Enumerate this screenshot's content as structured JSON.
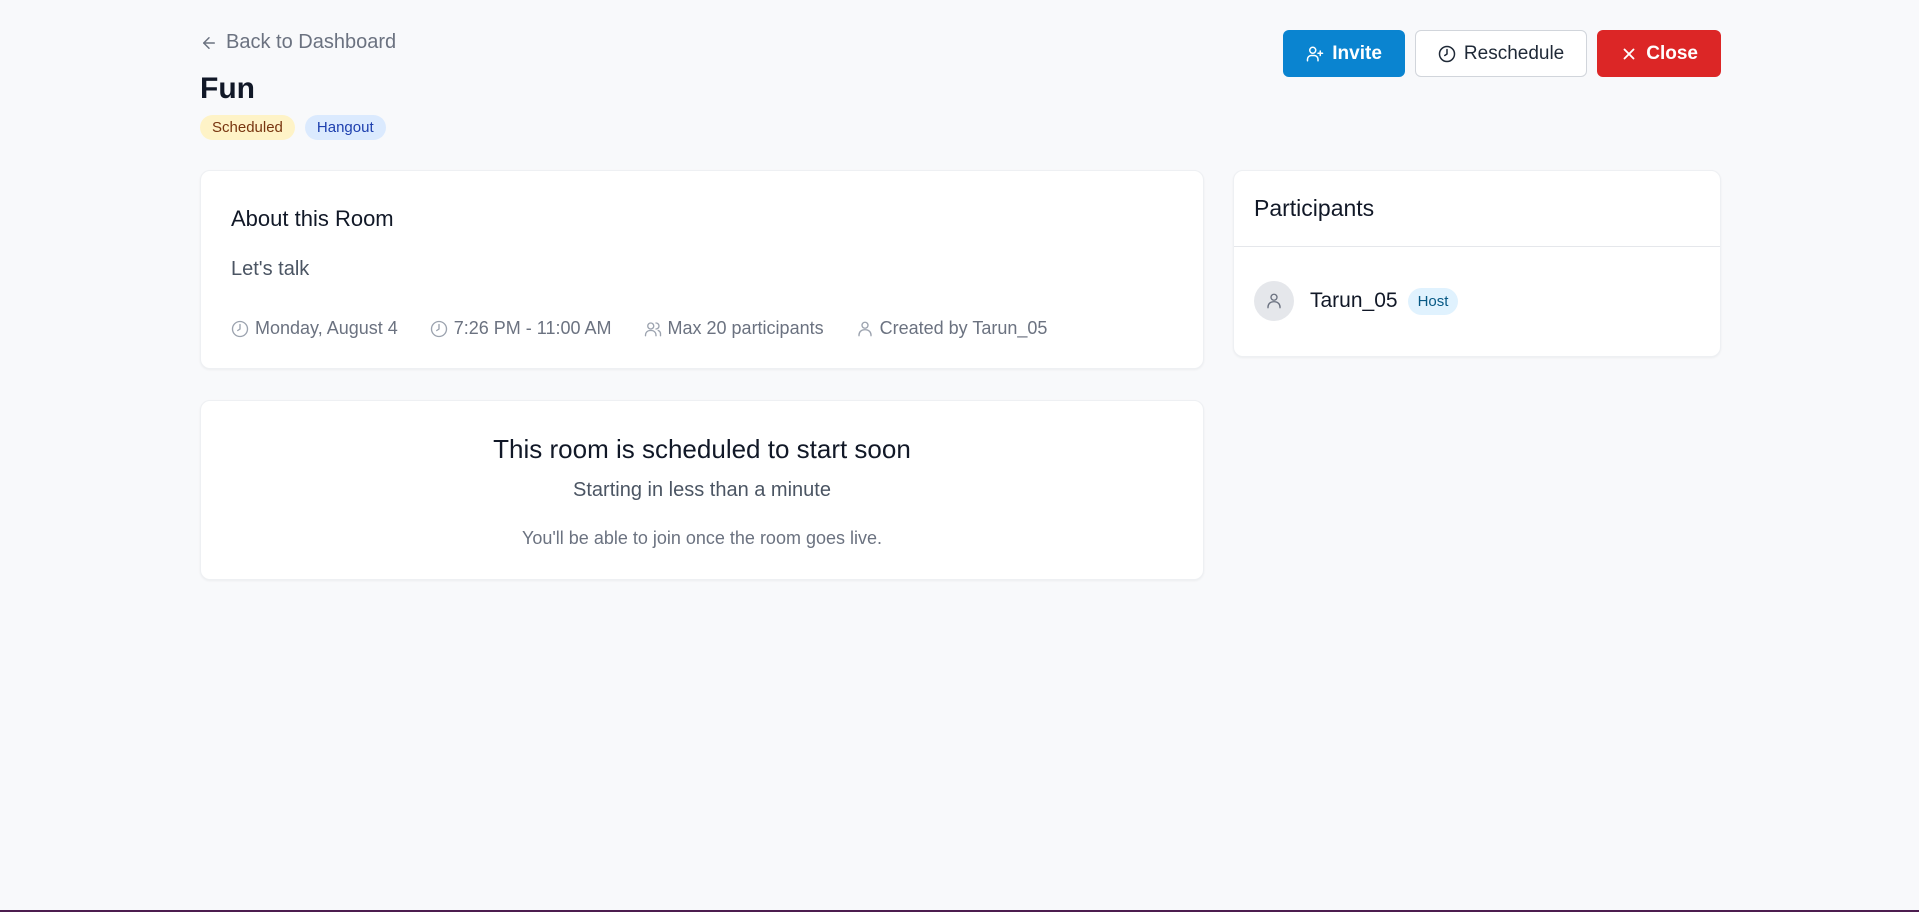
{
  "header": {
    "back_label": "Back to Dashboard",
    "title": "Fun",
    "badges": [
      "Scheduled",
      "Hangout"
    ]
  },
  "actions": {
    "invite_label": "Invite",
    "reschedule_label": "Reschedule",
    "close_label": "Close"
  },
  "about": {
    "heading": "About this Room",
    "description": "Let's talk",
    "meta": {
      "date": "Monday, August 4",
      "time": "7:26 PM - 11:00 AM",
      "capacity": "Max 20 participants",
      "creator": "Created by Tarun_05"
    }
  },
  "status": {
    "heading": "This room is scheduled to start soon",
    "subheading": "Starting in less than a minute",
    "note": "You'll be able to join once the room goes live."
  },
  "participants": {
    "heading": "Participants",
    "items": [
      {
        "name": "Tarun_05",
        "role": "Host"
      }
    ]
  },
  "colors": {
    "primary": "#0a84d0",
    "danger": "#dc2626",
    "scheduled_badge_bg": "#fef3c7",
    "hangout_badge_bg": "#dbeafe",
    "host_badge_bg": "#e0f2fe"
  }
}
